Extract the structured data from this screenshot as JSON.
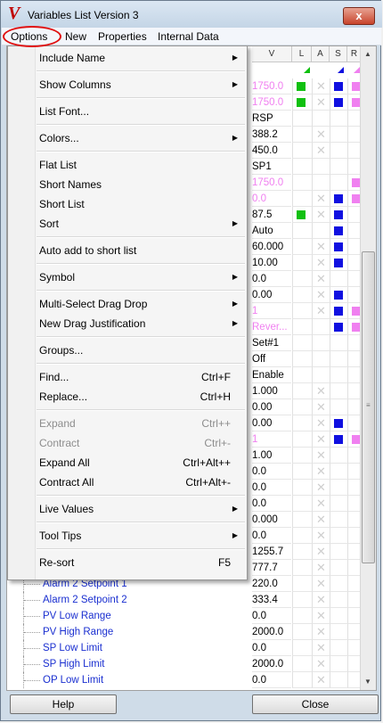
{
  "window": {
    "logo": "V",
    "title": "Variables List Version 3",
    "close_glyph": "x"
  },
  "menubar": {
    "items": [
      "Options",
      "New",
      "Properties",
      "Internal Data"
    ]
  },
  "columns": {
    "value": "V",
    "l": "L",
    "a": "A",
    "s": "S",
    "r": "R"
  },
  "colors": {
    "green": "#10c010",
    "blue": "#1010e0",
    "pink": "#f080f0",
    "gray_text": "#f080f0",
    "link": "#1a2fd0"
  },
  "rows": [
    {
      "value": "1750.0",
      "pink": true,
      "l": "green",
      "a": "x",
      "s": "blue",
      "r": "pink"
    },
    {
      "value": "1750.0",
      "pink": true,
      "l": "green",
      "a": "x",
      "s": "blue",
      "r": "pink"
    },
    {
      "value": "RSP",
      "pink": false,
      "l": "",
      "a": "",
      "s": "",
      "r": ""
    },
    {
      "value": "388.2",
      "pink": false,
      "l": "",
      "a": "x",
      "s": "",
      "r": ""
    },
    {
      "value": "450.0",
      "pink": false,
      "l": "",
      "a": "x",
      "s": "",
      "r": ""
    },
    {
      "value": "SP1",
      "pink": false,
      "l": "",
      "a": "",
      "s": "",
      "r": ""
    },
    {
      "value": "1750.0",
      "pink": true,
      "l": "",
      "a": "",
      "s": "",
      "r": "pink"
    },
    {
      "value": "0.0",
      "pink": true,
      "l": "",
      "a": "x",
      "s": "blue",
      "r": "pink"
    },
    {
      "value": "87.5",
      "pink": false,
      "l": "green",
      "a": "x",
      "s": "blue",
      "r": ""
    },
    {
      "value": "Auto",
      "pink": false,
      "l": "",
      "a": "",
      "s": "blue",
      "r": ""
    },
    {
      "value": "60.000",
      "pink": false,
      "l": "",
      "a": "x",
      "s": "blue",
      "r": ""
    },
    {
      "value": "10.00",
      "pink": false,
      "l": "",
      "a": "x",
      "s": "blue",
      "r": ""
    },
    {
      "value": "0.0",
      "pink": false,
      "l": "",
      "a": "x",
      "s": "",
      "r": ""
    },
    {
      "value": "0.00",
      "pink": false,
      "l": "",
      "a": "x",
      "s": "blue",
      "r": ""
    },
    {
      "value": "1",
      "pink": true,
      "l": "",
      "a": "x",
      "s": "blue",
      "r": "pink"
    },
    {
      "value": "Rever...",
      "pink": true,
      "l": "",
      "a": "",
      "s": "blue",
      "r": "pink"
    },
    {
      "value": "Set#1",
      "pink": false,
      "l": "",
      "a": "",
      "s": "",
      "r": ""
    },
    {
      "value": "Off",
      "pink": false,
      "l": "",
      "a": "",
      "s": "",
      "r": ""
    },
    {
      "value": "Enable",
      "pink": false,
      "l": "",
      "a": "",
      "s": "",
      "r": ""
    },
    {
      "value": "1.000",
      "pink": false,
      "l": "",
      "a": "x",
      "s": "",
      "r": ""
    },
    {
      "value": "0.00",
      "pink": false,
      "l": "",
      "a": "x",
      "s": "",
      "r": ""
    },
    {
      "value": "0.00",
      "pink": false,
      "l": "",
      "a": "x",
      "s": "blue",
      "r": ""
    },
    {
      "value": "1",
      "pink": true,
      "l": "",
      "a": "x",
      "s": "blue",
      "r": "pink"
    },
    {
      "value": "1.00",
      "pink": false,
      "l": "",
      "a": "x",
      "s": "",
      "r": ""
    },
    {
      "value": "0.0",
      "pink": false,
      "l": "",
      "a": "x",
      "s": "",
      "r": ""
    },
    {
      "value": "0.0",
      "pink": false,
      "l": "",
      "a": "x",
      "s": "",
      "r": ""
    },
    {
      "value": "0.0",
      "pink": false,
      "l": "",
      "a": "x",
      "s": "",
      "r": ""
    },
    {
      "value": "0.000",
      "pink": false,
      "l": "",
      "a": "x",
      "s": "",
      "r": ""
    },
    {
      "value": "0.0",
      "pink": false,
      "l": "",
      "a": "x",
      "s": "",
      "r": ""
    },
    {
      "value": "1255.7",
      "pink": false,
      "l": "",
      "a": "x",
      "s": "",
      "r": ""
    },
    {
      "value": "777.7",
      "pink": false,
      "l": "",
      "a": "x",
      "s": "",
      "r": ""
    },
    {
      "value": "220.0",
      "pink": false,
      "l": "",
      "a": "x",
      "s": "",
      "r": "",
      "name": "Alarm 2 Setpoint 1"
    },
    {
      "value": "333.4",
      "pink": false,
      "l": "",
      "a": "x",
      "s": "",
      "r": "",
      "name": "Alarm 2 Setpoint 2"
    },
    {
      "value": "0.0",
      "pink": false,
      "l": "",
      "a": "x",
      "s": "",
      "r": "",
      "name": "PV Low Range"
    },
    {
      "value": "2000.0",
      "pink": false,
      "l": "",
      "a": "x",
      "s": "",
      "r": "",
      "name": "PV High Range"
    },
    {
      "value": "0.0",
      "pink": false,
      "l": "",
      "a": "x",
      "s": "",
      "r": "",
      "name": "SP Low Limit"
    },
    {
      "value": "2000.0",
      "pink": false,
      "l": "",
      "a": "x",
      "s": "",
      "r": "",
      "name": "SP High Limit"
    },
    {
      "value": "0.0",
      "pink": false,
      "l": "",
      "a": "x",
      "s": "",
      "r": "",
      "name": "OP Low Limit"
    }
  ],
  "buttons": {
    "help": "Help",
    "close": "Close"
  },
  "options_menu": [
    {
      "label": "Include Name",
      "submenu": true,
      "y": 0
    },
    {
      "label": "Show Columns",
      "submenu": true,
      "y": 1
    },
    {
      "label": "List Font...",
      "y": 2
    },
    {
      "label": "Colors...",
      "submenu": true,
      "y": 3
    },
    {
      "label": "Flat List",
      "y": 4
    },
    {
      "label": "Short Names",
      "y": 5
    },
    {
      "label": "Short List",
      "y": 6
    },
    {
      "label": "Sort",
      "submenu": true,
      "y": 7
    },
    {
      "label": "Auto add to short list",
      "y": 8
    },
    {
      "label": "Symbol",
      "submenu": true,
      "y": 9
    },
    {
      "label": "Multi-Select Drag Drop",
      "submenu": true,
      "y": 10
    },
    {
      "label": "New Drag Justification",
      "submenu": true,
      "y": 11
    },
    {
      "label": "Groups...",
      "y": 12
    },
    {
      "label": "Find...",
      "shortcut": "Ctrl+F",
      "y": 13
    },
    {
      "label": "Replace...",
      "shortcut": "Ctrl+H",
      "y": 14
    },
    {
      "label": "Expand",
      "shortcut": "Ctrl++",
      "disabled": true,
      "y": 15
    },
    {
      "label": "Contract",
      "shortcut": "Ctrl+-",
      "disabled": true,
      "y": 16
    },
    {
      "label": "Expand All",
      "shortcut": "Ctrl+Alt++",
      "y": 17
    },
    {
      "label": "Contract All",
      "shortcut": "Ctrl+Alt+-",
      "y": 18
    },
    {
      "label": "Live Values",
      "submenu": true,
      "y": 19
    },
    {
      "label": "Tool Tips",
      "submenu": true,
      "y": 20
    },
    {
      "label": "Re-sort",
      "shortcut": "F5",
      "y": 21
    }
  ]
}
